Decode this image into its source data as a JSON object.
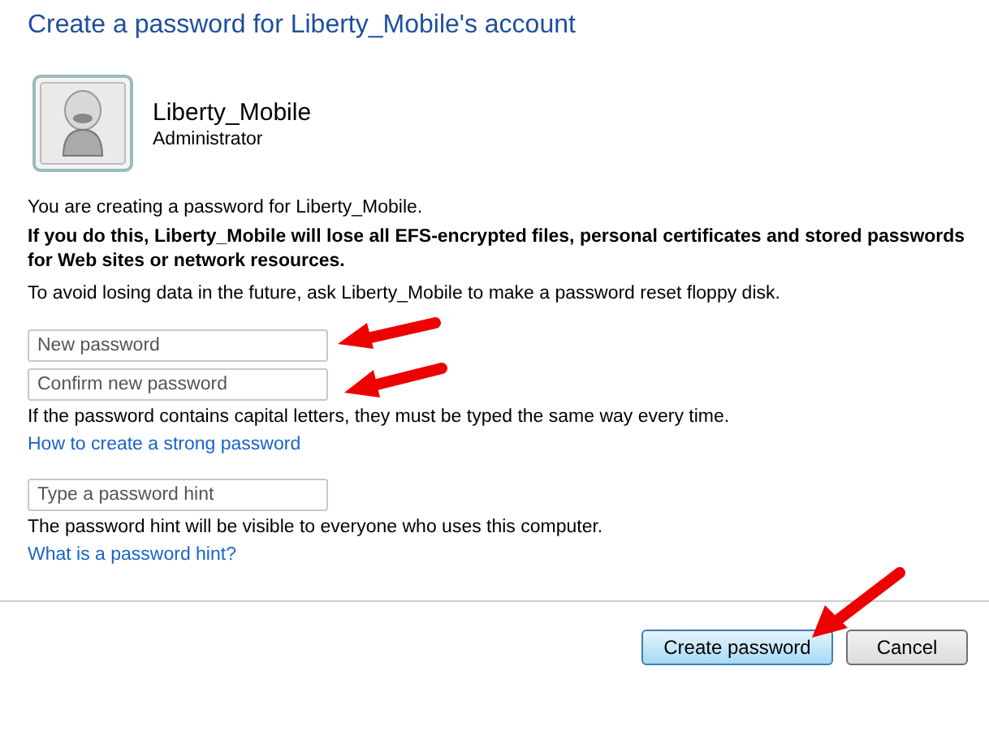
{
  "title": "Create a password for Liberty_Mobile's account",
  "user": {
    "name": "Liberty_Mobile",
    "role": "Administrator"
  },
  "intro": "You are creating a password for Liberty_Mobile.",
  "warning": "If you do this, Liberty_Mobile will lose all EFS-encrypted files, personal certificates and stored passwords for Web sites or network resources.",
  "advice": "To avoid losing data in the future, ask Liberty_Mobile to make a password reset floppy disk.",
  "password_fields": [
    {
      "placeholder": "New password"
    },
    {
      "placeholder": "Confirm new password"
    }
  ],
  "case_note": "If the password contains capital letters, they must be typed the same way every time.",
  "strong_link": "How to create a strong password",
  "hint_field": {
    "placeholder": "Type a password hint"
  },
  "hint_note": "The password hint will be visible to everyone who uses this computer.",
  "hint_link": "What is a password hint?",
  "buttons": [
    {
      "label": "Create password",
      "default": true
    },
    {
      "label": "Cancel",
      "default": false
    }
  ]
}
